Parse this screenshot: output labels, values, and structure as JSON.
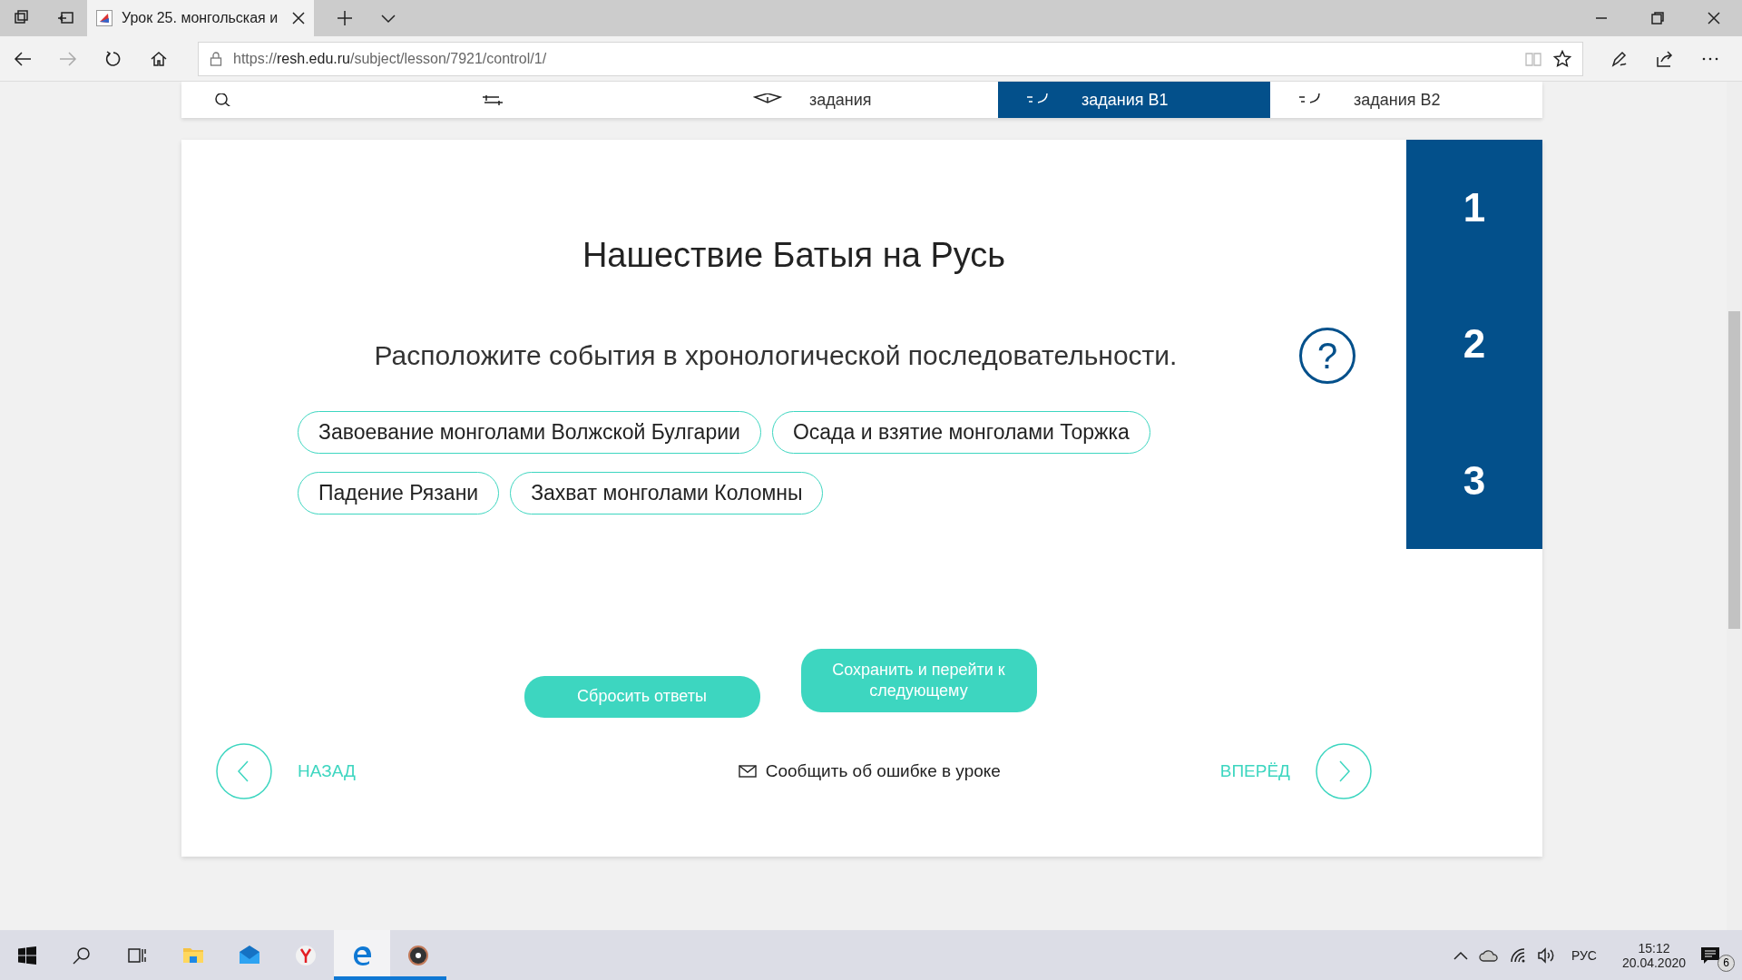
{
  "browser": {
    "tabs": [
      {
        "title": "Урок 25. монгольская и",
        "selected": true
      }
    ],
    "address": {
      "scheme": "https://",
      "host": "resh.edu.ru",
      "path": "/subject/lesson/7921/control/1/"
    }
  },
  "lesson_nav": {
    "items": [
      {
        "selected": false
      },
      {
        "selected": false
      },
      {
        "label": "задания",
        "selected": false
      },
      {
        "label": "задания В1",
        "selected": true
      },
      {
        "label": "задания В2",
        "selected": false
      }
    ]
  },
  "task": {
    "title": "Нашествие Батыя на Русь",
    "prompt": "Расположите события в хронологической последовательности.",
    "help": "?",
    "options": [
      "Завоевание монголами Волжской Булгарии",
      "Осада и взятие монголами Торжка",
      "Падение Рязани",
      "Захват монголами Коломны"
    ],
    "slots": [
      "1",
      "2",
      "3"
    ],
    "buttons": {
      "reset": "Сбросить ответы",
      "save": "Сохранить и перейти к следующему"
    }
  },
  "footer": {
    "back": "НАЗАД",
    "report": "Сообщить об ошибке в уроке",
    "forward": "ВПЕРЁД"
  },
  "taskbar": {
    "apps": [
      {
        "kind": "explorer",
        "active": false,
        "open": false
      },
      {
        "kind": "mail",
        "active": false,
        "open": false
      },
      {
        "kind": "yandex",
        "active": false,
        "open": false
      },
      {
        "kind": "edge",
        "active": true,
        "open": true
      },
      {
        "kind": "player",
        "active": false,
        "open": true
      }
    ],
    "language": "РУС",
    "time": "15:12",
    "date": "20.04.2020",
    "notifications": "6"
  }
}
